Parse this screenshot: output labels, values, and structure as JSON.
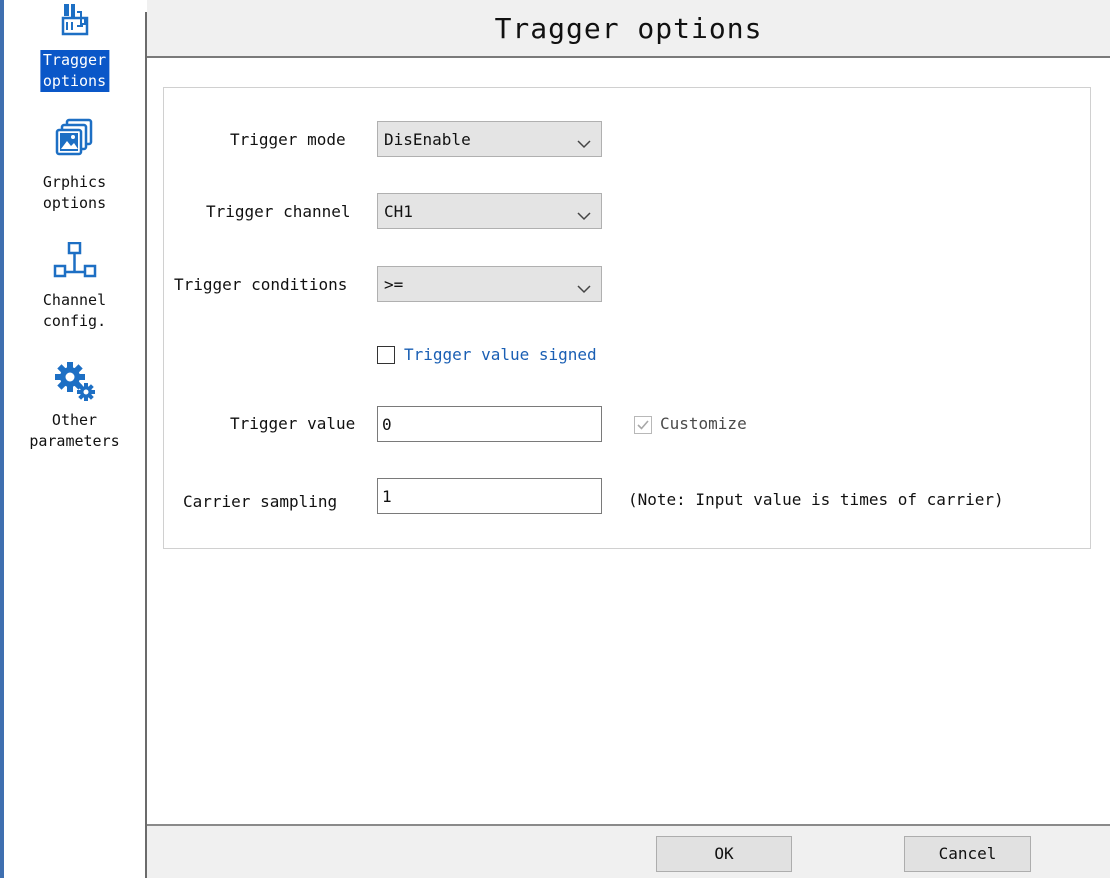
{
  "sidebar": {
    "items": [
      {
        "label": "Tragger\noptions",
        "icon": "trigger-options-icon",
        "selected": true
      },
      {
        "label": "Grphics\noptions",
        "icon": "graphics-options-icon",
        "selected": false
      },
      {
        "label": "Channel\nconfig.",
        "icon": "channel-config-icon",
        "selected": false
      },
      {
        "label": "Other\nparameters",
        "icon": "gears-icon",
        "selected": false
      }
    ]
  },
  "header": {
    "title": "Tragger options"
  },
  "form": {
    "trigger_mode": {
      "label": "Trigger mode",
      "value": "DisEnable"
    },
    "trigger_channel": {
      "label": "Trigger channel",
      "value": "CH1"
    },
    "trigger_conditions": {
      "label": "Trigger conditions",
      "value": ">="
    },
    "trigger_value_signed": {
      "label": "Trigger value signed",
      "checked": false
    },
    "trigger_value": {
      "label": "Trigger value",
      "value": "0"
    },
    "customize": {
      "label": "Customize",
      "checked": true,
      "disabled": true
    },
    "carrier_sampling": {
      "label": "Carrier sampling",
      "value": "1",
      "note": "(Note: Input value is times of carrier)"
    }
  },
  "footer": {
    "ok_label": "OK",
    "cancel_label": "Cancel"
  },
  "colors": {
    "accent": "#0a57c8",
    "link_text": "#1a5fb4",
    "disabled_text": "#4a4a4a"
  }
}
